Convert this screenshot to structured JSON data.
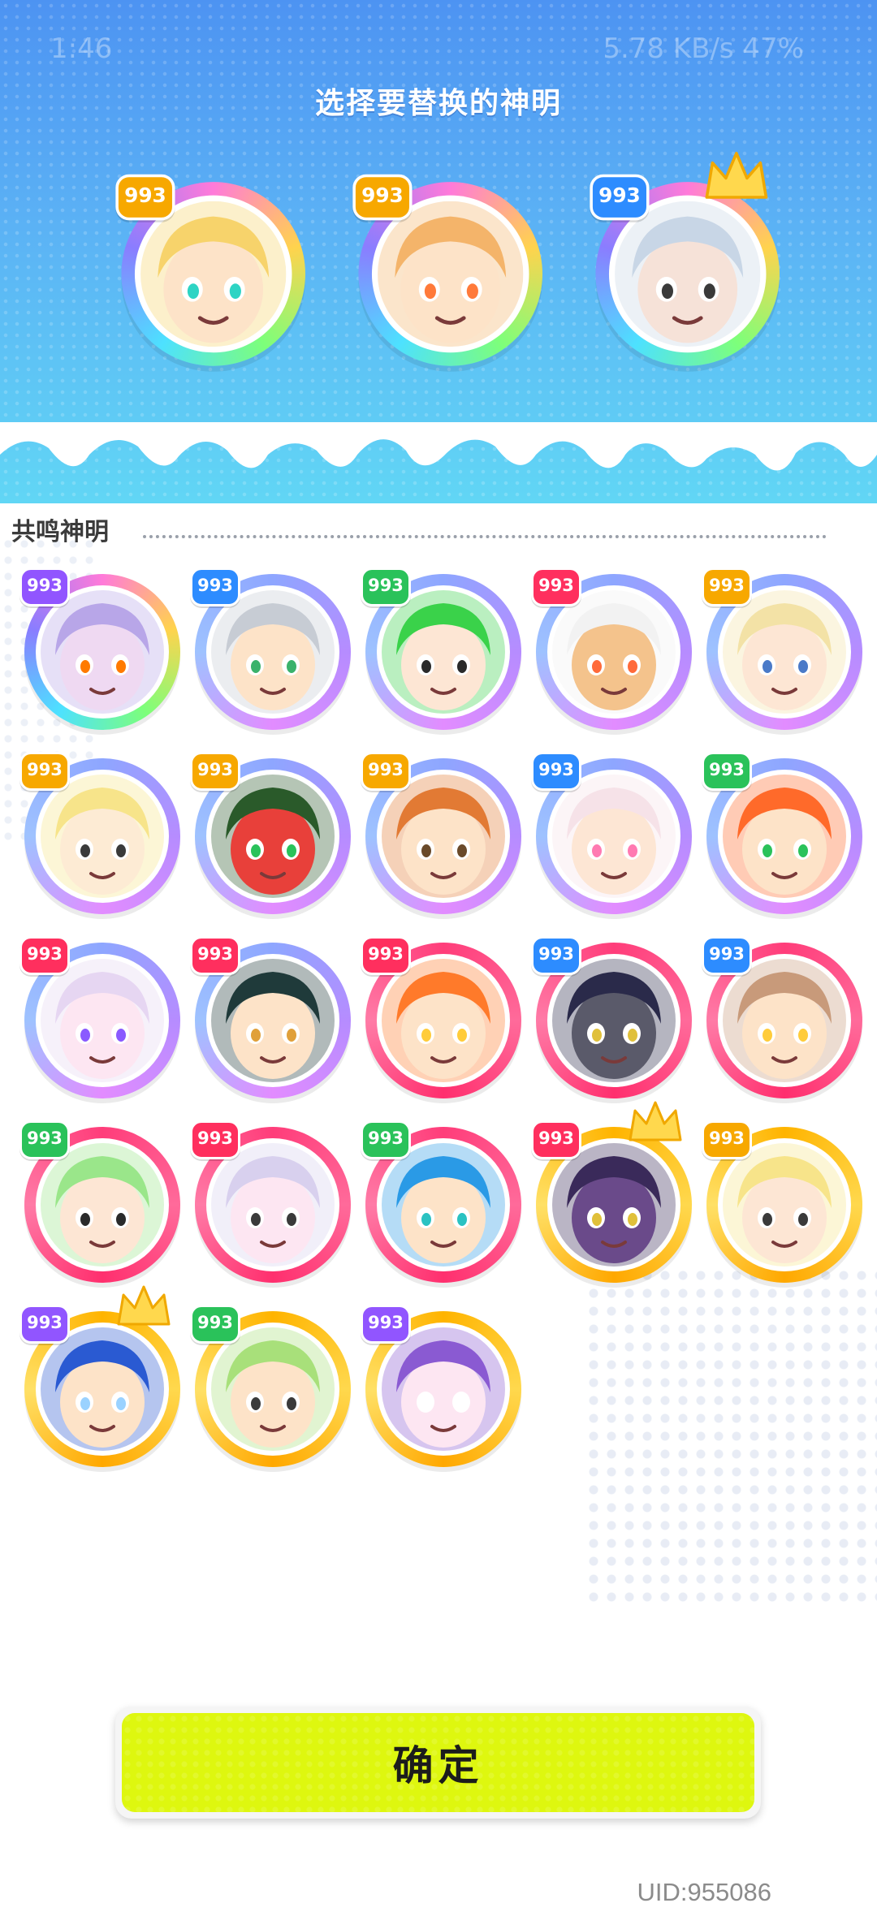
{
  "status_bar": {
    "time": "1:46",
    "right_text": "5.78 KB/s 47%"
  },
  "header": {
    "title": "选择要替换的神明"
  },
  "selected_gods": [
    {
      "level": "993",
      "ring": "rainbow",
      "badge": "gold",
      "hair": "#f7d36b",
      "skin": "#fde3c8",
      "accent": "#2dd4c4",
      "crown": false
    },
    {
      "level": "993",
      "ring": "rainbow",
      "badge": "gold",
      "hair": "#f4b46a",
      "skin": "#fde3c8",
      "accent": "#ff7a3a",
      "crown": false
    },
    {
      "level": "993",
      "ring": "rainbow",
      "badge": "blue",
      "hair": "#c8d6e6",
      "skin": "#f6e2d8",
      "accent": "#3a3a3a",
      "crown": true
    }
  ],
  "section": {
    "title": "共鸣神明"
  },
  "resonance_gods": [
    {
      "level": "993",
      "ring": "rainbow",
      "badge": "purple",
      "hair": "#b8a6e8",
      "skin": "#efd9f2",
      "accent": "#ff7a00",
      "crown": false
    },
    {
      "level": "993",
      "ring": "purple",
      "badge": "blue",
      "hair": "#c7ccd4",
      "skin": "#fde3c8",
      "accent": "#3ab26b",
      "crown": false
    },
    {
      "level": "993",
      "ring": "purple",
      "badge": "green",
      "hair": "#3ad24a",
      "skin": "#fde6d4",
      "accent": "#2a2a2a",
      "crown": false
    },
    {
      "level": "993",
      "ring": "purple",
      "badge": "red",
      "hair": "#f2f2f2",
      "skin": "#f4c38c",
      "accent": "#ff6a3a",
      "crown": false
    },
    {
      "level": "993",
      "ring": "purple",
      "badge": "gold",
      "hair": "#f3e2a6",
      "skin": "#fde6d4",
      "accent": "#4a7ac8",
      "crown": false
    },
    {
      "level": "993",
      "ring": "purple",
      "badge": "gold",
      "hair": "#f7e48a",
      "skin": "#fdebd4",
      "accent": "#3a3a3a",
      "crown": false
    },
    {
      "level": "993",
      "ring": "purple",
      "badge": "gold",
      "hair": "#2a5a2a",
      "skin": "#e8403a",
      "accent": "#2ac25a",
      "crown": false
    },
    {
      "level": "993",
      "ring": "purple",
      "badge": "gold",
      "hair": "#e27a34",
      "skin": "#fde3c8",
      "accent": "#6a4a2a",
      "crown": false
    },
    {
      "level": "993",
      "ring": "purple",
      "badge": "blue",
      "hair": "#f6e2e8",
      "skin": "#fde6d4",
      "accent": "#ff7ab2",
      "crown": false
    },
    {
      "level": "993",
      "ring": "purple",
      "badge": "green",
      "hair": "#ff6a2a",
      "skin": "#fde3c8",
      "accent": "#2ac25a",
      "crown": false
    },
    {
      "level": "993",
      "ring": "purple",
      "badge": "red",
      "hair": "#e6d6f2",
      "skin": "#fde6f2",
      "accent": "#8a5aff",
      "crown": false
    },
    {
      "level": "993",
      "ring": "purple",
      "badge": "red",
      "hair": "#1f3a3a",
      "skin": "#fde3c8",
      "accent": "#e0a03a",
      "crown": false
    },
    {
      "level": "993",
      "ring": "red",
      "badge": "red",
      "hair": "#ff7a2a",
      "skin": "#fde3c8",
      "accent": "#ffcc3a",
      "crown": false
    },
    {
      "level": "993",
      "ring": "red",
      "badge": "blue",
      "hair": "#2a2a4a",
      "skin": "#5a5a6a",
      "accent": "#e0c03a",
      "crown": false
    },
    {
      "level": "993",
      "ring": "red",
      "badge": "blue",
      "hair": "#c89a7a",
      "skin": "#fde3c8",
      "accent": "#ffcc3a",
      "crown": false
    },
    {
      "level": "993",
      "ring": "red",
      "badge": "green",
      "hair": "#9ae68a",
      "skin": "#fde6d4",
      "accent": "#2a2a2a",
      "crown": false
    },
    {
      "level": "993",
      "ring": "red",
      "badge": "red",
      "hair": "#d8d0ee",
      "skin": "#fde6f2",
      "accent": "#3a3a3a",
      "crown": false
    },
    {
      "level": "993",
      "ring": "red",
      "badge": "green",
      "hair": "#2a9ae6",
      "skin": "#fde3c8",
      "accent": "#2ac2c2",
      "crown": false
    },
    {
      "level": "993",
      "ring": "gold",
      "badge": "red",
      "hair": "#3a2a5a",
      "skin": "#6a4a8a",
      "accent": "#e0c03a",
      "crown": true
    },
    {
      "level": "993",
      "ring": "gold",
      "badge": "gold",
      "hair": "#f7e48a",
      "skin": "#fde6d4",
      "accent": "#3a3a3a",
      "crown": false
    },
    {
      "level": "993",
      "ring": "gold",
      "badge": "purple",
      "hair": "#2a5ad2",
      "skin": "#fde3c8",
      "accent": "#9ad2ff",
      "crown": true
    },
    {
      "level": "993",
      "ring": "gold",
      "badge": "green",
      "hair": "#a8e07a",
      "skin": "#fde3c8",
      "accent": "#3a3a3a",
      "crown": false
    },
    {
      "level": "993",
      "ring": "gold",
      "badge": "purple",
      "hair": "#8a5ad2",
      "skin": "#fde6f2",
      "accent": "#ffffff",
      "crown": false
    }
  ],
  "confirm": {
    "label": "确定"
  },
  "footer": {
    "uid": "UID:955086"
  }
}
